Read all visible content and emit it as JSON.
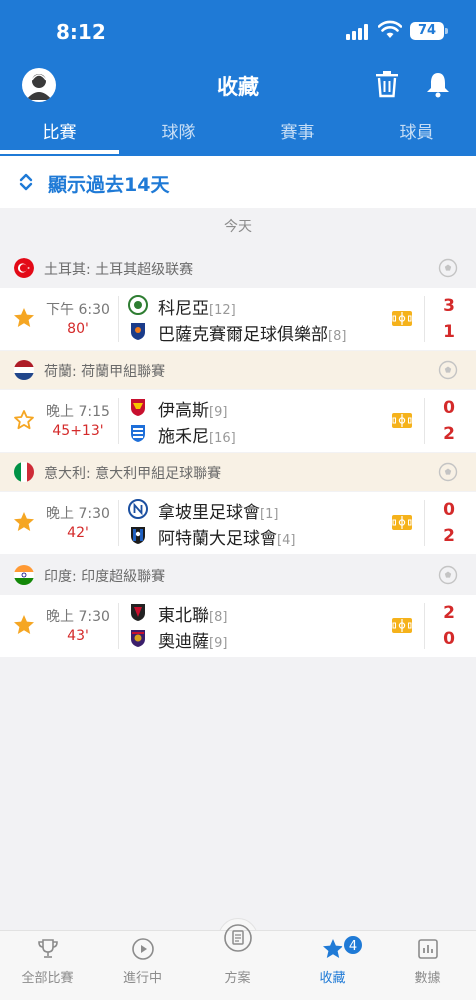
{
  "status": {
    "time": "8:12",
    "battery": "74"
  },
  "header": {
    "title": "收藏"
  },
  "tabs": [
    {
      "label": "比賽"
    },
    {
      "label": "球隊"
    },
    {
      "label": "賽事"
    },
    {
      "label": "球員"
    }
  ],
  "filter": {
    "label": "顯示過去14天"
  },
  "day": "今天",
  "leagues": [
    {
      "name": "土耳其: 土耳其超级联赛",
      "match": {
        "kickoff": "下午 6:30",
        "minute": "80'",
        "starred": true,
        "home": {
          "name": "科尼亞",
          "rank": "[12]",
          "score": "3"
        },
        "away": {
          "name": "巴薩克賽爾足球俱樂部",
          "rank": "[8]",
          "score": "1"
        }
      }
    },
    {
      "name": "荷蘭: 荷蘭甲組聯賽",
      "match": {
        "kickoff": "晚上 7:15",
        "minute": "45+13'",
        "starred": false,
        "home": {
          "name": "伊高斯",
          "rank": "[9]",
          "score": "0"
        },
        "away": {
          "name": "施禾尼",
          "rank": "[16]",
          "score": "2"
        }
      }
    },
    {
      "name": "意大利: 意大利甲組足球聯賽",
      "match": {
        "kickoff": "晚上 7:30",
        "minute": "42'",
        "starred": true,
        "home": {
          "name": "拿坡里足球會",
          "rank": "[1]",
          "score": "0"
        },
        "away": {
          "name": "阿特蘭大足球會",
          "rank": "[4]",
          "score": "2"
        }
      }
    },
    {
      "name": "印度: 印度超級聯賽",
      "match": {
        "kickoff": "晚上 7:30",
        "minute": "43'",
        "starred": true,
        "home": {
          "name": "東北聯",
          "rank": "[8]",
          "score": "2"
        },
        "away": {
          "name": "奧迪薩",
          "rank": "[9]",
          "score": "0"
        }
      }
    }
  ],
  "bottom_nav": [
    {
      "label": "全部比賽",
      "icon": "trophy-icon"
    },
    {
      "label": "進行中",
      "icon": "play-icon"
    },
    {
      "label": "方案",
      "icon": "document-icon"
    },
    {
      "label": "收藏",
      "icon": "star-icon"
    },
    {
      "label": "數據",
      "icon": "bar-chart-icon"
    }
  ],
  "favorites_badge": "4",
  "colors": {
    "brand": "#1f7ad6",
    "live": "#d42a2a",
    "star": "#f5a623"
  }
}
